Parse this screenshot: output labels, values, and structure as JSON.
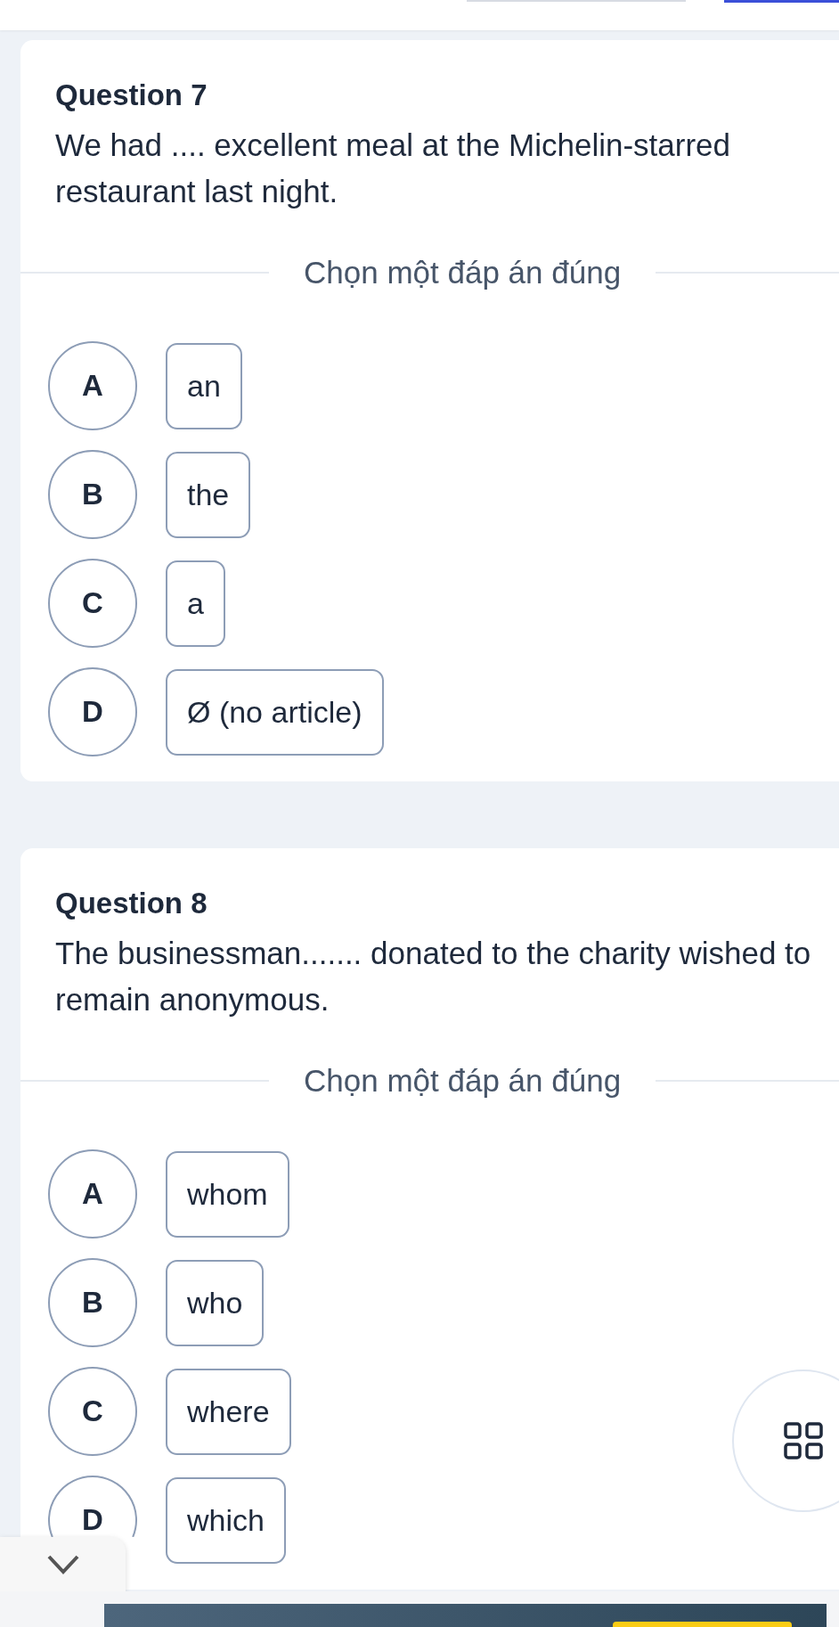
{
  "tabs": [
    {
      "selected": false
    },
    {
      "selected": true
    }
  ],
  "questions": [
    {
      "title": "Question 7",
      "text": "We had .... excellent meal at the Michelin-starred restaurant last night.",
      "instruction": "Chọn một đáp án đúng",
      "options": [
        {
          "letter": "A",
          "text": "an",
          "selected": false
        },
        {
          "letter": "B",
          "text": "the",
          "selected": false
        },
        {
          "letter": "C",
          "text": "a",
          "selected": false
        },
        {
          "letter": "D",
          "text": "Ø (no article)",
          "selected": false
        }
      ]
    },
    {
      "title": "Question 8",
      "text": "The businessman....... donated to the charity wished to remain anonymous.",
      "instruction": "Chọn một đáp án đúng",
      "options": [
        {
          "letter": "A",
          "text": "whom",
          "selected": false
        },
        {
          "letter": "B",
          "text": "who",
          "selected": false
        },
        {
          "letter": "C",
          "text": "where",
          "selected": false
        },
        {
          "letter": "D",
          "text": "which",
          "selected": false
        }
      ]
    }
  ]
}
